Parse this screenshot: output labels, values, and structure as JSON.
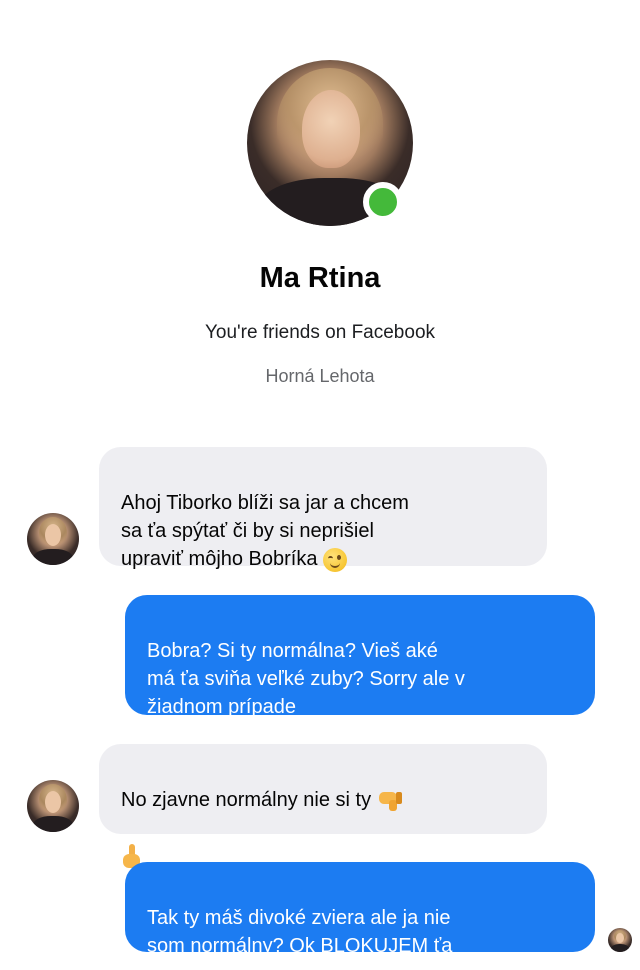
{
  "contact": {
    "name": "Ma Rtina",
    "friend_status": "You're friends on Facebook",
    "location": "Horná Lehota"
  },
  "messages": [
    {
      "direction": "incoming",
      "text": "Ahoj Tiborko blíži sa jar a chcem\nsa ťa spýtať či by si neprišiel\nupraviť môjho Bobríka",
      "emoji": "wink-emoji"
    },
    {
      "direction": "outgoing",
      "text": "Bobra? Si ty normálna? Vieš aké\nmá ťa sviňa veľké zuby? Sorry ale v\nžiadnom prípade"
    },
    {
      "direction": "incoming",
      "text": "No zjavne normálny nie si ty",
      "emoji": "thumbs-down-emoji",
      "emoji2": "middle-finger-emoji"
    },
    {
      "direction": "outgoing",
      "text": "Tak ty máš divoké zviera ale ja nie\nsom normálny? Ok BLOKUJEM ťa"
    }
  ],
  "colors": {
    "outgoing_bubble": "#1c7cf2",
    "incoming_bubble": "#eeeef2",
    "online_indicator": "#44b93a"
  },
  "icons": [
    "online-status-icon",
    "wink-emoji",
    "thumbs-down-emoji",
    "middle-finger-emoji",
    "seen-avatar-icon"
  ]
}
